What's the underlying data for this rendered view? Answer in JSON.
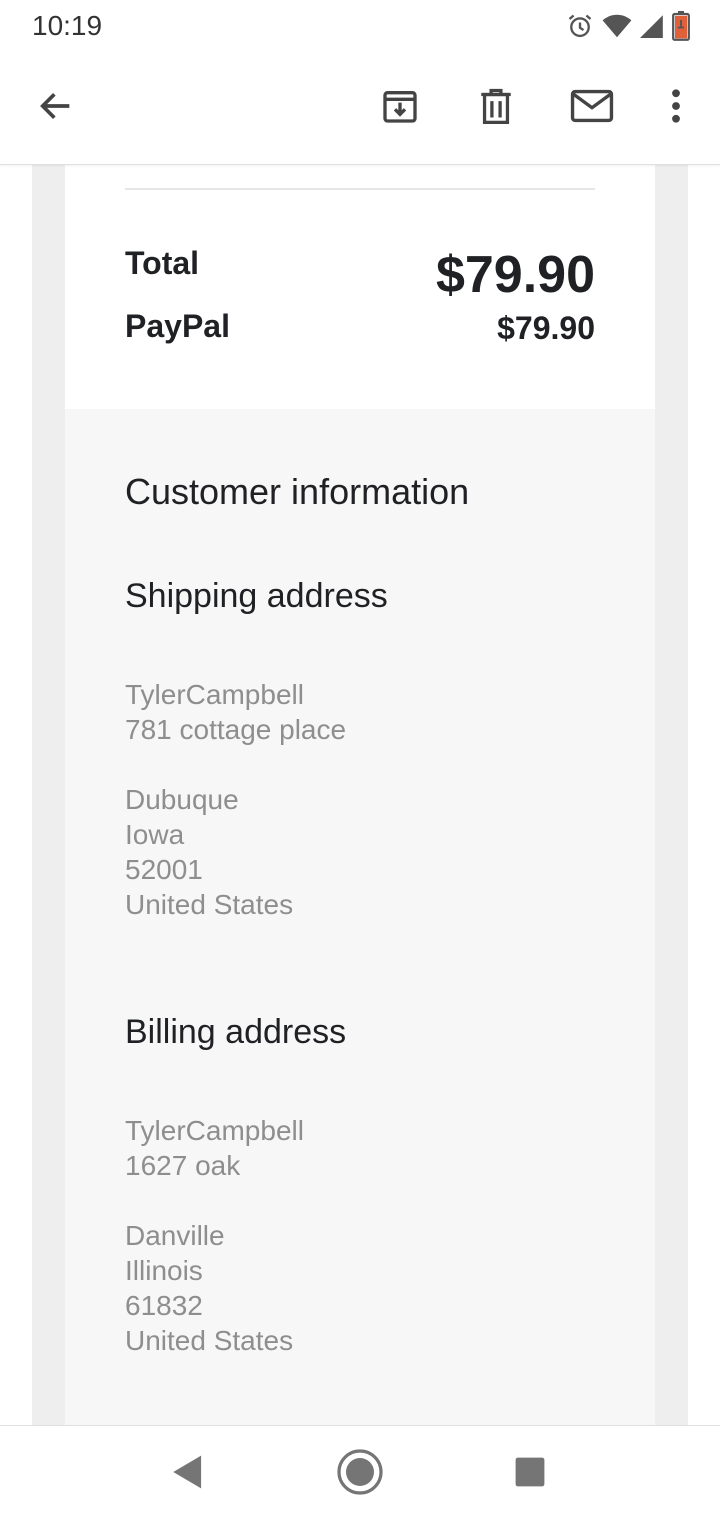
{
  "status_bar": {
    "time": "10:19",
    "icons": [
      "alarm-icon",
      "wifi-icon",
      "signal-icon",
      "battery-icon"
    ]
  },
  "app_bar": {
    "icons": [
      "back-arrow-icon",
      "archive-icon",
      "delete-icon",
      "mail-icon",
      "more-vert-icon"
    ]
  },
  "order": {
    "total_label": "Total",
    "total_value": "$79.90",
    "paypal_label": "PayPal",
    "paypal_value": "$79.90"
  },
  "customer": {
    "heading": "Customer information",
    "shipping": {
      "heading": "Shipping address",
      "name": "TylerCampbell",
      "street": "781 cottage place",
      "city": "Dubuque",
      "state": "Iowa",
      "zip": "52001",
      "country": "United States"
    },
    "billing": {
      "heading": "Billing address",
      "name": "TylerCampbell",
      "street": "1627 oak",
      "city": "Danville",
      "state": "Illinois",
      "zip": "61832",
      "country": "United States"
    }
  },
  "colors": {
    "text_primary": "#202124",
    "text_secondary": "#8e8e8e",
    "panel_grey": "#f7f7f7",
    "frame_grey": "#eeeeee",
    "battery_accent": "#e0603a"
  },
  "nav_bar": {
    "icons": [
      "nav-back-icon",
      "nav-home-icon",
      "nav-recents-icon"
    ]
  }
}
